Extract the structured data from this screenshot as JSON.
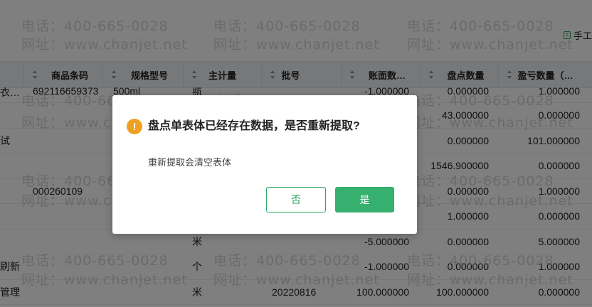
{
  "toolbar": {
    "manual_label": "手工"
  },
  "table": {
    "headers": [
      {
        "label": "商品条码"
      },
      {
        "label": "规格型号"
      },
      {
        "label": "主计量"
      },
      {
        "label": "批号"
      },
      {
        "label": "账面数…"
      },
      {
        "label": "盘点数量"
      },
      {
        "label": "盈亏数量（…"
      }
    ],
    "rows": [
      [
        "衣…",
        "6921166593​73",
        "500ml",
        "瓶",
        "",
        "-1.000000",
        "0.000000",
        "1.000000"
      ],
      [
        "",
        "",
        "",
        "",
        "",
        "",
        "43.000000",
        "0.000000"
      ],
      [
        "试",
        "",
        "",
        "",
        "",
        "",
        "0.000000",
        "101.000000"
      ],
      [
        "",
        "",
        "",
        "",
        "",
        "",
        "1546.900000",
        "0.000000"
      ],
      [
        "",
        "000260109",
        "",
        "",
        "",
        "",
        "0.000000",
        "1.000000"
      ],
      [
        "",
        "",
        "",
        "",
        "",
        "",
        "1.000000",
        "0.000000"
      ],
      [
        "",
        "",
        "",
        "米",
        "",
        "-5.000000",
        "0.000000",
        "5.000000"
      ],
      [
        "刷新",
        "",
        "",
        "个",
        "",
        "-1.000000",
        "0.000000",
        "1.000000"
      ],
      [
        "管理",
        "",
        "",
        "米",
        "20220816",
        "100.000000",
        "100.000000",
        "0.000000"
      ]
    ]
  },
  "watermark": {
    "phone": "电话：400-665-0028",
    "site": "网址：www.chanjet.net"
  },
  "dialog": {
    "title": "盘点单表体已经存在数据，是否重新提取?",
    "message": "重新提取会清空表体",
    "no_label": "否",
    "yes_label": "是",
    "warning_symbol": "!"
  }
}
